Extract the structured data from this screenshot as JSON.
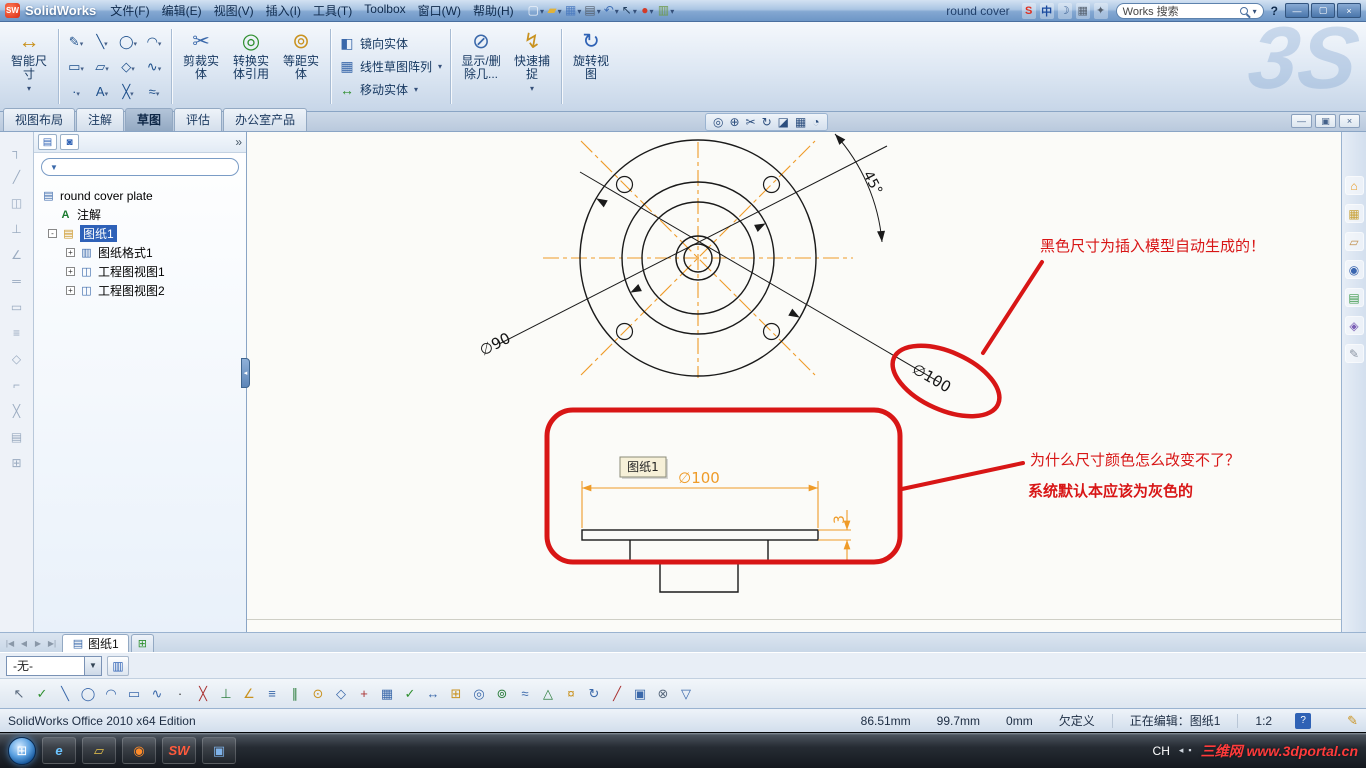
{
  "titlebar": {
    "logo_text": "SW",
    "app_name": "SolidWorks",
    "menus": [
      "文件(F)",
      "编辑(E)",
      "视图(V)",
      "插入(I)",
      "工具(T)",
      "Toolbox",
      "窗口(W)",
      "帮助(H)"
    ],
    "qat": [
      {
        "name": "new-document-icon",
        "g": "▢",
        "c": "#f2f6fb"
      },
      {
        "name": "open-icon",
        "g": "▰",
        "c": "#e0b23a"
      },
      {
        "name": "save-icon",
        "g": "▦",
        "c": "#4d7cc0"
      },
      {
        "name": "print-icon",
        "g": "▤",
        "c": "#55606e"
      },
      {
        "name": "undo-icon",
        "g": "↶",
        "c": "#3f6fb5"
      },
      {
        "name": "select-arrow-icon",
        "g": "↖",
        "c": "#24405f"
      },
      {
        "name": "red-ball-icon",
        "g": "●",
        "c": "#d23a28"
      },
      {
        "name": "list-icon",
        "g": "▥",
        "c": "#6f9a4a"
      }
    ],
    "doc_text": "round cover",
    "ime": [
      {
        "name": "sogou-icon",
        "g": "S",
        "c": "#e03020"
      },
      {
        "name": "lang-chinese-icon",
        "g": "中",
        "c": "#1a4a9e"
      },
      {
        "name": "moon-icon",
        "g": "☽",
        "c": "#355a8c"
      },
      {
        "name": "keyboard-icon",
        "g": "▦",
        "c": "#55606e"
      },
      {
        "name": "ime-tools-icon",
        "g": "✦",
        "c": "#55606e"
      }
    ],
    "search_text": "Works 搜索",
    "help_text": "?",
    "win_min": "—",
    "win_max": "▢",
    "win_close": "×"
  },
  "ribbon": {
    "smart_dim": "智能尺寸",
    "big_icons": {
      "smart": "↔",
      "trim": "✂",
      "convert": "◎",
      "offset": "⊚",
      "mirror": "◧",
      "pattern": "▦",
      "move": "↔",
      "display": "⊘",
      "snap": "↯",
      "rotate": "↻"
    },
    "sketch_tools": [
      {
        "g": "✎"
      },
      {
        "g": "╲"
      },
      {
        "g": "◯"
      },
      {
        "g": "◠"
      },
      {
        "g": "▭"
      },
      {
        "g": "▱"
      },
      {
        "g": "◇"
      },
      {
        "g": "∿"
      },
      {
        "g": "·"
      },
      {
        "g": "A"
      },
      {
        "g": "╳"
      },
      {
        "g": "≈"
      }
    ],
    "trim": "剪裁实体",
    "convert": "转换实体引用",
    "offset": "等距实体",
    "mirror": "镜向实体",
    "linear_pattern": "线性草图阵列",
    "move": "移动实体",
    "display_delete": "显示/删除几...",
    "quick_snap": "快速捕捉",
    "rotate_view": "旋转视图",
    "brand_watermark": "3S"
  },
  "tabs": [
    "视图布局",
    "注解",
    "草图",
    "评估",
    "办公室产品"
  ],
  "view_toolbar": [
    {
      "name": "zoom-fit-icon",
      "g": "◎"
    },
    {
      "name": "zoom-area-icon",
      "g": "⊕"
    },
    {
      "name": "section-view-icon",
      "g": "✂"
    },
    {
      "name": "pan-rotate-icon",
      "g": "↻"
    },
    {
      "name": "display-style-icon",
      "g": "◪"
    },
    {
      "name": "hide-show-items-icon",
      "g": "▦"
    },
    {
      "name": "view-orientation-icon",
      "g": "◔"
    }
  ],
  "doc_window": {
    "min": "—",
    "restore": "▣",
    "close": "×"
  },
  "left_strip": [
    {
      "g": "┐"
    },
    {
      "g": "╱"
    },
    {
      "g": "◫"
    },
    {
      "g": "⊥"
    },
    {
      "g": "∠"
    },
    {
      "g": "═"
    },
    {
      "g": "▭"
    },
    {
      "g": "≡"
    },
    {
      "g": "◇"
    },
    {
      "g": "⌐"
    },
    {
      "g": "╳"
    },
    {
      "g": "▤"
    },
    {
      "g": "⊞"
    }
  ],
  "feature_tree": {
    "funnel_glyph": "▼",
    "chevron": "»",
    "tab1_glyph": "▤",
    "tab2_glyph": "◙",
    "root": "round cover plate",
    "root_icon": "▤",
    "annotations": "注解",
    "annotations_icon": "A",
    "sheet": "图纸1",
    "sheet_icon": "▤",
    "expand_minus": "-",
    "expand_plus": "+",
    "child_icons": [
      "▥",
      "◫",
      "◫"
    ],
    "children": [
      "图纸格式1",
      "工程图视图1",
      "工程图视图2"
    ]
  },
  "drawing": {
    "dim_d90": "∅90",
    "dim_d100": "∅100",
    "dim_angle": "45°",
    "side_dim_diameter": "∅100",
    "side_dim_thickness": "3",
    "tooltip": "图纸1",
    "note_top": "黑色尺寸为插入模型自动生成的！",
    "note_question": "为什么尺寸颜色怎么改变不了？",
    "note_default": "系统默认本应该为灰色的",
    "red_color": "#d81616",
    "dim_orange": "#ef9b28"
  },
  "task_pane": [
    {
      "name": "solidworks-resources-icon",
      "g": "⌂",
      "c": "#e8991f"
    },
    {
      "name": "design-library-icon",
      "g": "▦",
      "c": "#c9a23a"
    },
    {
      "name": "file-explorer-icon",
      "g": "▱",
      "c": "#c09050"
    },
    {
      "name": "search-icon",
      "g": "◉",
      "c": "#3a66b0"
    },
    {
      "name": "view-palette-icon",
      "g": "▤",
      "c": "#3f9a4d"
    },
    {
      "name": "appearances-icon",
      "g": "◈",
      "c": "#7a5fb5"
    },
    {
      "name": "custom-properties-icon",
      "g": "✎",
      "c": "#8a94a2"
    }
  ],
  "sheet_bar": {
    "nav": [
      {
        "g": "|◀"
      },
      {
        "g": "◀"
      },
      {
        "g": "▶"
      },
      {
        "g": "▶|"
      }
    ],
    "tab": "图纸1",
    "tab_icon": "▤",
    "add_glyph": "⊞"
  },
  "format_bar": {
    "value": "-无-",
    "icon_glyph": "▥"
  },
  "snap_bar": [
    {
      "g": "↖",
      "c": "#5a6a7e"
    },
    {
      "g": "✓",
      "c": "#2f8f2f"
    },
    {
      "g": "╲",
      "c": "#3a68aa"
    },
    {
      "g": "◯",
      "c": "#3a68aa"
    },
    {
      "g": "◠",
      "c": "#3a68aa"
    },
    {
      "g": "▭",
      "c": "#3a68aa"
    },
    {
      "g": "∿",
      "c": "#3a68aa"
    },
    {
      "g": "·",
      "c": "#333333"
    },
    {
      "g": "╳",
      "c": "#aa3333"
    },
    {
      "g": "⊥",
      "c": "#2f7f3f"
    },
    {
      "g": "∠",
      "c": "#c9921f"
    },
    {
      "g": "≡",
      "c": "#3a68aa"
    },
    {
      "g": "∥",
      "c": "#2f7f3f"
    },
    {
      "g": "⊙",
      "c": "#c9921f"
    },
    {
      "g": "◇",
      "c": "#3a68aa"
    },
    {
      "g": "+",
      "c": "#aa3333"
    },
    {
      "g": "▦",
      "c": "#3a68aa"
    },
    {
      "g": "✓",
      "c": "#2f8f2f"
    },
    {
      "g": "↔",
      "c": "#3a68aa"
    },
    {
      "g": "⊞",
      "c": "#c9921f"
    },
    {
      "g": "◎",
      "c": "#3a68aa"
    },
    {
      "g": "⊚",
      "c": "#2f7f3f"
    },
    {
      "g": "≈",
      "c": "#3a68aa"
    },
    {
      "g": "△",
      "c": "#2f7f3f"
    },
    {
      "g": "¤",
      "c": "#c9921f"
    },
    {
      "g": "↻",
      "c": "#3a68aa"
    },
    {
      "g": "╱",
      "c": "#aa3333"
    },
    {
      "g": "▣",
      "c": "#3a68aa"
    },
    {
      "g": "⊗",
      "c": "#5a6a7e"
    },
    {
      "g": "▽",
      "c": "#3a68aa"
    }
  ],
  "statusbar": {
    "edition": "SolidWorks Office 2010 x64 Edition",
    "x": "86.51mm",
    "y": "99.7mm",
    "z": "0mm",
    "state": "欠定义",
    "editing": "正在编辑：图纸1",
    "scale": "1:2",
    "help_glyph": "?",
    "pencil_glyph": "✎"
  },
  "taskbar": {
    "start_glyph": "⊞",
    "apps": [
      {
        "name": "internet-explorer-icon",
        "g": "e",
        "c": "#6cc4ff"
      },
      {
        "name": "windows-explorer-icon",
        "g": "▱",
        "c": "#e8c34a"
      },
      {
        "name": "media-player-icon",
        "g": "◉",
        "c": "#ff8c2a"
      },
      {
        "name": "solidworks-taskbar-icon",
        "g": "SW",
        "c": "#ff5a3c"
      },
      {
        "name": "document-window-icon",
        "g": "▣",
        "c": "#7fb2e8"
      }
    ],
    "lang": "CH",
    "tray_glyphs": [
      {
        "g": "◂"
      },
      {
        "g": "▪"
      }
    ],
    "watermark": "三维网 www.3dportal.cn"
  }
}
